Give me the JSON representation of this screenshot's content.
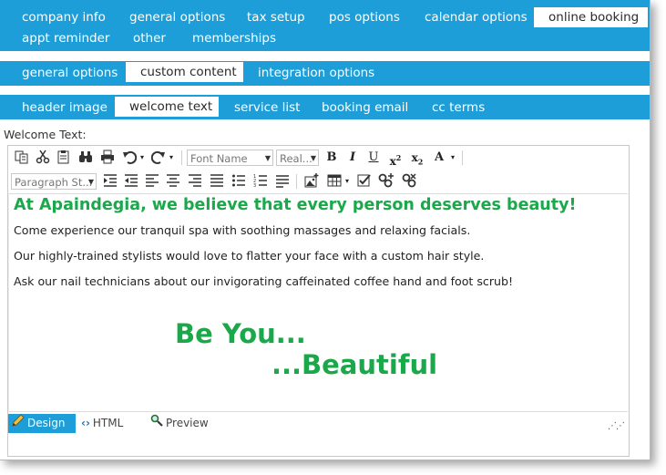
{
  "nav1": {
    "row1": [
      "company info",
      "general options",
      "tax setup",
      "pos options",
      "calendar options",
      "online booking"
    ],
    "row2": [
      "appt reminder",
      "other",
      "memberships"
    ],
    "active": "online booking"
  },
  "nav2": {
    "tabs": [
      "general options",
      "custom content",
      "integration options"
    ],
    "active": "custom content"
  },
  "nav3": {
    "tabs": [
      "header image",
      "welcome text",
      "service list",
      "booking email",
      "cc terms"
    ],
    "active": "welcome text"
  },
  "welcome_label": "Welcome Text:",
  "toolbar": {
    "font_name": "Font Name",
    "font_size": "Real...",
    "paragraph_style": "Paragraph St...",
    "bold": "B",
    "italic": "I",
    "underline": "U"
  },
  "content": {
    "headline": "At Apaindegia, we believe that every person deserves beauty!",
    "paragraphs": [
      "Come experience our tranquil spa with soothing massages and relaxing facials.",
      "Our highly-trained stylists would love to flatter your face with a custom hair style.",
      "Ask our nail technicians about our invigorating caffeinated coffee hand and foot scrub!"
    ],
    "tagline1": "Be You...",
    "tagline2": "...Beautiful"
  },
  "modes": {
    "design": "Design",
    "html": "HTML",
    "preview": "Preview",
    "active": "Design"
  },
  "colors": {
    "bar": "#1e9ed8",
    "green_text": "#1aa84a"
  }
}
